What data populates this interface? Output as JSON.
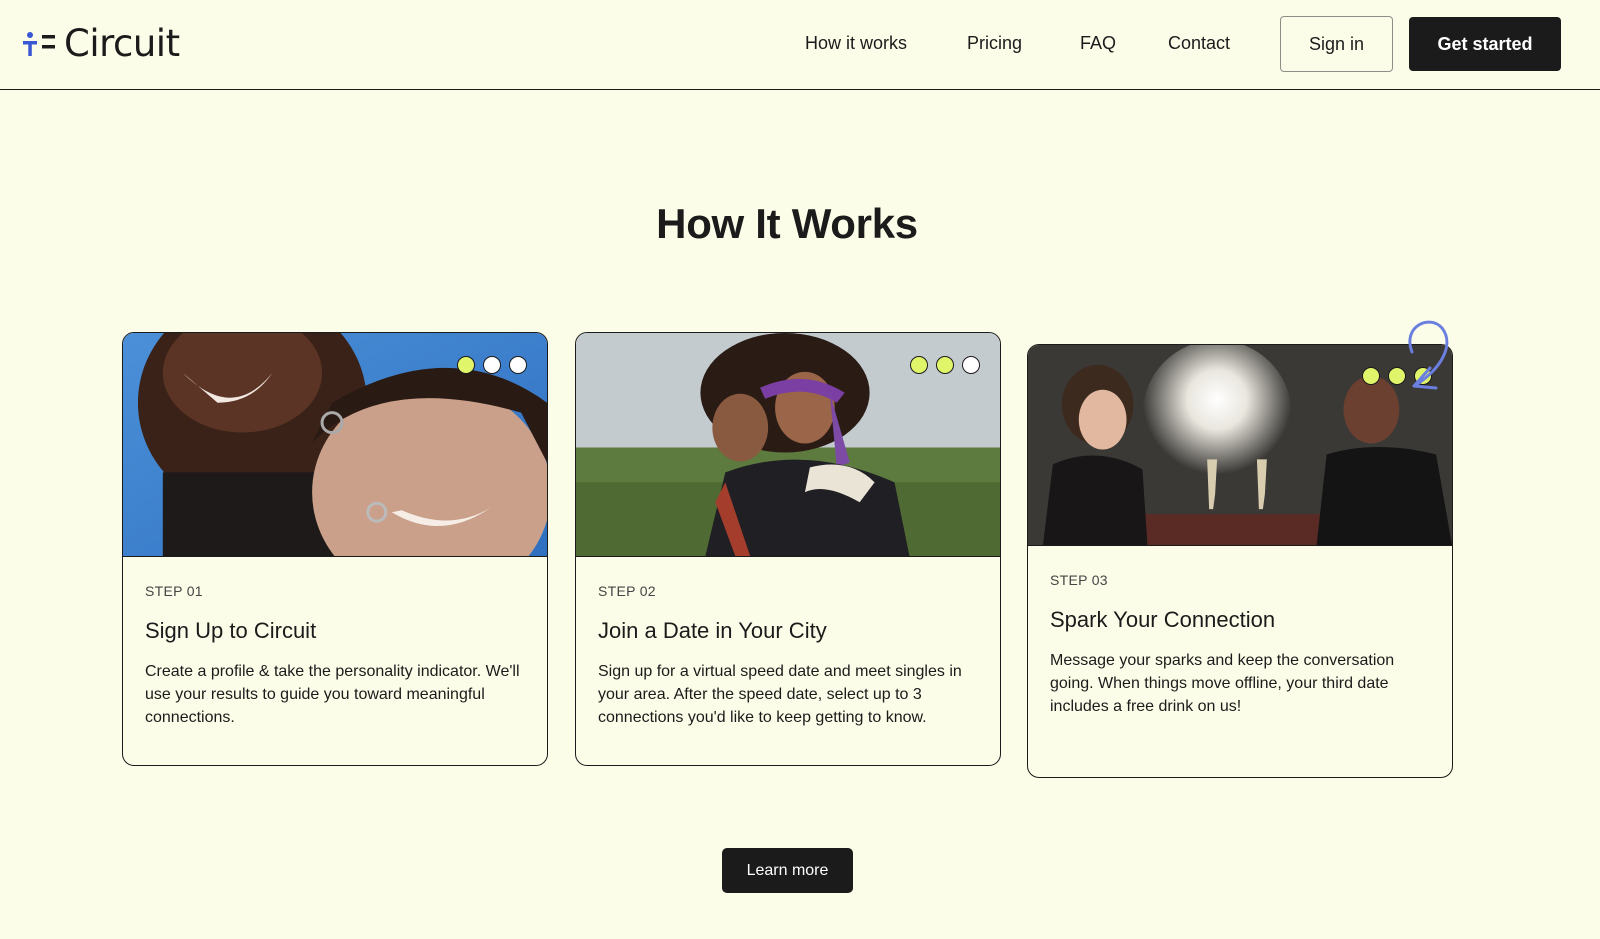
{
  "brand": {
    "name": "Circuit",
    "logo_icon": "circuit-logo-icon",
    "colors": {
      "accent": "#e1f56b",
      "brand_blue": "#3a57d6",
      "ink": "#1b1b1b",
      "background": "#fcfde8"
    }
  },
  "nav": {
    "links": [
      "How it works",
      "Pricing",
      "FAQ",
      "Contact"
    ],
    "sign_in": "Sign in",
    "get_started": "Get started"
  },
  "section": {
    "title": "How It Works"
  },
  "steps": [
    {
      "step": "STEP 01",
      "title": "Sign Up to Circuit",
      "description": "Create a profile & take the personality indicator. We'll use your results to guide you toward meaningful connections.",
      "dots_active": 1
    },
    {
      "step": "STEP 02",
      "title": "Join a Date in Your City",
      "description": "Sign up for a virtual speed date and meet singles in your area. After the speed date, select up to 3 connections you'd like to keep getting to know.",
      "dots_active": 2
    },
    {
      "step": "STEP 03",
      "title": "Spark Your Connection",
      "description": "Message your sparks and keep the conversation going. When things move offline, your third date includes a free drink on us!",
      "dots_active": 3
    }
  ],
  "cta": {
    "learn_more": "Learn more"
  }
}
